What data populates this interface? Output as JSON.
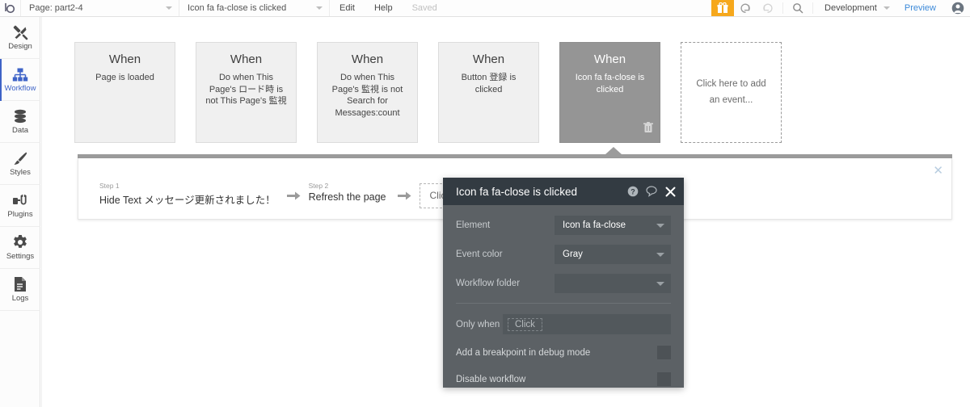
{
  "topbar": {
    "logo_icon": "bubble-logo-icon",
    "page_selector": {
      "label": "Page: part2-4",
      "caret_icon": "chevron-down-icon"
    },
    "workflow_selector": {
      "label": "Icon fa fa-close is clicked",
      "caret_icon": "chevron-down-icon"
    },
    "edit_label": "Edit",
    "help_label": "Help",
    "saved_label": "Saved",
    "gift_icon": "gift-icon",
    "undo_icon": "undo-icon",
    "redo_icon": "redo-icon",
    "search_icon": "search-icon",
    "version_label": "Development",
    "version_caret_icon": "chevron-down-icon",
    "preview_label": "Preview",
    "avatar_icon": "user-avatar-icon",
    "accent_orange": "#f6a81c",
    "preview_blue": "#3d8ad9"
  },
  "sidebar": {
    "items": [
      {
        "label": "Design",
        "icon": "design-icon",
        "active": false
      },
      {
        "label": "Workflow",
        "icon": "workflow-icon",
        "active": true
      },
      {
        "label": "Data",
        "icon": "database-icon",
        "active": false
      },
      {
        "label": "Styles",
        "icon": "brush-icon",
        "active": false
      },
      {
        "label": "Plugins",
        "icon": "plugins-icon",
        "active": false
      },
      {
        "label": "Settings",
        "icon": "gear-icon",
        "active": false
      },
      {
        "label": "Logs",
        "icon": "document-icon",
        "active": false
      }
    ],
    "active_color": "#3e63c7",
    "collapse_icon": "collapse-arrow-icon"
  },
  "events": {
    "cards": [
      {
        "when": "When",
        "desc": "Page is loaded",
        "selected": false
      },
      {
        "when": "When",
        "desc": "Do when This Page's ロード時 is not This Page's 監視",
        "selected": false
      },
      {
        "when": "When",
        "desc": "Do when This Page's 監視 is not Search for Messages:count",
        "selected": false
      },
      {
        "when": "When",
        "desc": "Button 登録 is clicked",
        "selected": false
      },
      {
        "when": "When",
        "desc": "Icon fa fa-close is clicked",
        "selected": true
      }
    ],
    "add_card_label": "Click here to add an event...",
    "delete_icon": "trash-icon",
    "selected_bg": "#959595"
  },
  "steps": {
    "close_icon": "close-icon",
    "items": [
      {
        "num": "Step 1",
        "title": "Hide Text メッセージ更新されました！"
      },
      {
        "num": "Step 2",
        "title": "Refresh the page"
      }
    ],
    "arrow_icon": "arrow-right-icon",
    "add_step_label": "Click here to add an action..."
  },
  "panel": {
    "title": "Icon fa fa-close is clicked",
    "help_icon": "help-circle-icon",
    "comment_icon": "comment-bubble-icon",
    "close_icon": "close-icon",
    "fields": [
      {
        "label": "Element",
        "value": "Icon fa fa-close",
        "caret_icon": "chevron-down-icon"
      },
      {
        "label": "Event color",
        "value": "Gray",
        "caret_icon": "chevron-down-icon"
      },
      {
        "label": "Workflow folder",
        "value": "",
        "caret_icon": "chevron-down-icon"
      }
    ],
    "only_when": {
      "label": "Only when",
      "placeholder": "Click"
    },
    "checkboxes": [
      {
        "label": "Add a breakpoint in debug mode",
        "checked": false
      },
      {
        "label": "Disable workflow",
        "checked": false
      }
    ],
    "bg": "#5c6165",
    "header_bg": "#333b42"
  }
}
